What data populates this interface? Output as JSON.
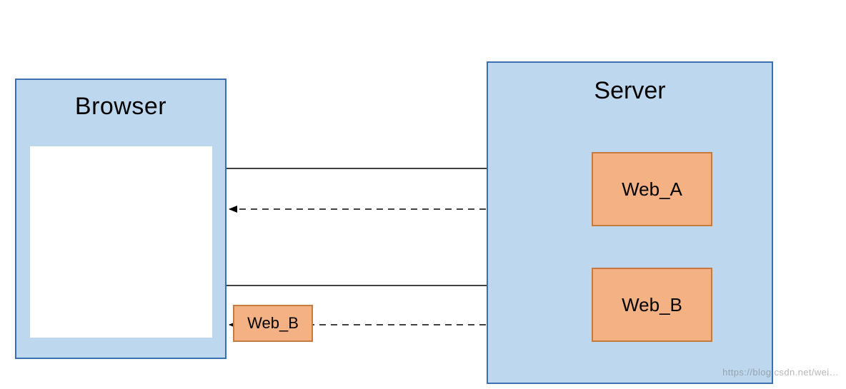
{
  "browser": {
    "title": "Browser"
  },
  "server": {
    "title": "Server",
    "web_a_label": "Web_A",
    "web_b_label": "Web_B"
  },
  "floating": {
    "web_b_label": "Web_B"
  },
  "watermark": "https://blog.csdn.net/wei…"
}
